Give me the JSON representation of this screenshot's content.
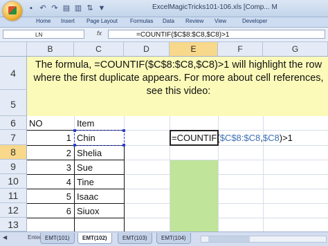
{
  "window": {
    "title": "ExcelMagicTricks101-106.xls  [Comp... M"
  },
  "quick_access": {
    "icons": [
      "save-icon",
      "undo-icon",
      "redo-icon",
      "quick-print-icon",
      "chart-icon",
      "sort-icon",
      "filter-icon"
    ]
  },
  "ribbon": {
    "tabs": [
      "Home",
      "Insert",
      "Page Layout",
      "Formulas",
      "Data",
      "Review",
      "View",
      "Developer"
    ]
  },
  "formula_bar": {
    "name_box": "LN",
    "fx": "fx",
    "formula": "=COUNTIF($C$8:$C8,$C8)>1"
  },
  "columns": [
    "B",
    "C",
    "D",
    "E",
    "F",
    "G"
  ],
  "selected_column": "E",
  "rows": [
    "4",
    "5",
    "6",
    "7",
    "8",
    "9",
    "10",
    "11",
    "12",
    "13"
  ],
  "selected_row": "8",
  "banner": {
    "text": "The formula, =COUNTIF($C$8:$C8,$C8)>1 will highlight the row where the first duplicate appears. For more about cell references, see this video:"
  },
  "table": {
    "header_no": "NO",
    "header_item": "Item",
    "rows": [
      {
        "no": "1",
        "item": "Chin"
      },
      {
        "no": "2",
        "item": "Shelia"
      },
      {
        "no": "3",
        "item": "Sue"
      },
      {
        "no": "4",
        "item": "Tine"
      },
      {
        "no": "5",
        "item": "Isaac"
      },
      {
        "no": "6",
        "item": "Siuox"
      }
    ]
  },
  "editing_cell": {
    "prefix": "=COUNTIF(",
    "range_ref": "$C$8:$C8",
    "sep": ",",
    "crit_ref": "$C8",
    "suffix": ")>1"
  },
  "sheet_tabs": {
    "tabs": [
      "EMT(101)",
      "EMT(102)",
      "EMT(103)",
      "EMT(104)"
    ],
    "active": "EMT(102)"
  },
  "status": {
    "mode": "Enter"
  }
}
